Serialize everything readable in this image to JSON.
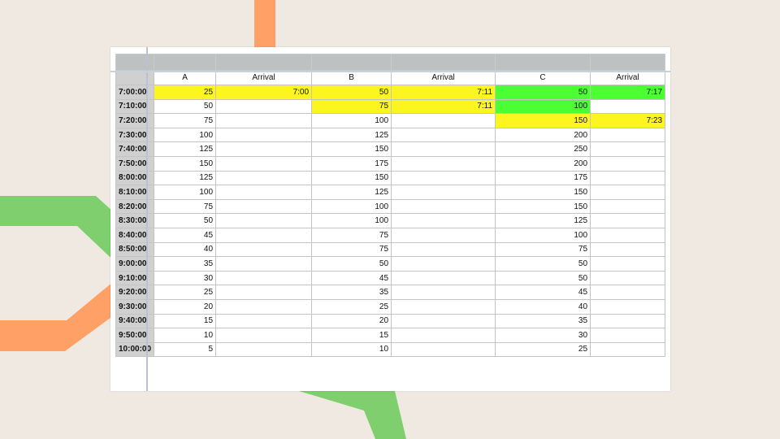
{
  "spreadsheet": {
    "columns": [
      "A",
      "Arrival",
      "B",
      "Arrival",
      "C",
      "Arrival"
    ],
    "rows": [
      {
        "time": "7:00:00",
        "cells": [
          "25",
          "7:00",
          "50",
          "7:11",
          "50",
          "7:17"
        ]
      },
      {
        "time": "7:10:00",
        "cells": [
          "50",
          "",
          "75",
          "7:11",
          "100",
          ""
        ]
      },
      {
        "time": "7:20:00",
        "cells": [
          "75",
          "",
          "100",
          "",
          "150",
          "7:23"
        ]
      },
      {
        "time": "7:30:00",
        "cells": [
          "100",
          "",
          "125",
          "",
          "200",
          ""
        ]
      },
      {
        "time": "7:40:00",
        "cells": [
          "125",
          "",
          "150",
          "",
          "250",
          ""
        ]
      },
      {
        "time": "7:50:00",
        "cells": [
          "150",
          "",
          "175",
          "",
          "200",
          ""
        ]
      },
      {
        "time": "8:00:00",
        "cells": [
          "125",
          "",
          "150",
          "",
          "175",
          ""
        ]
      },
      {
        "time": "8:10:00",
        "cells": [
          "100",
          "",
          "125",
          "",
          "150",
          ""
        ]
      },
      {
        "time": "8:20:00",
        "cells": [
          "75",
          "",
          "100",
          "",
          "150",
          ""
        ]
      },
      {
        "time": "8:30:00",
        "cells": [
          "50",
          "",
          "100",
          "",
          "125",
          ""
        ]
      },
      {
        "time": "8:40:00",
        "cells": [
          "45",
          "",
          "75",
          "",
          "100",
          ""
        ]
      },
      {
        "time": "8:50:00",
        "cells": [
          "40",
          "",
          "75",
          "",
          "75",
          ""
        ]
      },
      {
        "time": "9:00:00",
        "cells": [
          "35",
          "",
          "50",
          "",
          "50",
          ""
        ]
      },
      {
        "time": "9:10:00",
        "cells": [
          "30",
          "",
          "45",
          "",
          "50",
          ""
        ]
      },
      {
        "time": "9:20:00",
        "cells": [
          "25",
          "",
          "35",
          "",
          "45",
          ""
        ]
      },
      {
        "time": "9:30:00",
        "cells": [
          "20",
          "",
          "25",
          "",
          "40",
          ""
        ]
      },
      {
        "time": "9:40:00",
        "cells": [
          "15",
          "",
          "20",
          "",
          "35",
          ""
        ]
      },
      {
        "time": "9:50:00",
        "cells": [
          "10",
          "",
          "15",
          "",
          "30",
          ""
        ]
      },
      {
        "time": "10:00:00",
        "cells": [
          "5",
          "",
          "10",
          "",
          "25",
          ""
        ]
      }
    ],
    "highlights": [
      {
        "row": 0,
        "col": 0,
        "color": "#fcf520"
      },
      {
        "row": 0,
        "col": 1,
        "color": "#fcf520"
      },
      {
        "row": 0,
        "col": 2,
        "color": "#fcf520"
      },
      {
        "row": 0,
        "col": 3,
        "color": "#fcf520"
      },
      {
        "row": 0,
        "col": 4,
        "color": "#4cff33"
      },
      {
        "row": 0,
        "col": 5,
        "color": "#4cff33"
      },
      {
        "row": 1,
        "col": 2,
        "color": "#fcf520"
      },
      {
        "row": 1,
        "col": 3,
        "color": "#fcf520"
      },
      {
        "row": 1,
        "col": 4,
        "color": "#4cff33"
      },
      {
        "row": 2,
        "col": 4,
        "color": "#fcf520"
      },
      {
        "row": 2,
        "col": 5,
        "color": "#fcf520"
      }
    ]
  },
  "colors": {
    "background": "#f0e9e2",
    "accent_orange": "#ffa167",
    "accent_green": "#7fcf6e",
    "highlight_yellow": "#fcf520",
    "highlight_green": "#4cff33"
  }
}
